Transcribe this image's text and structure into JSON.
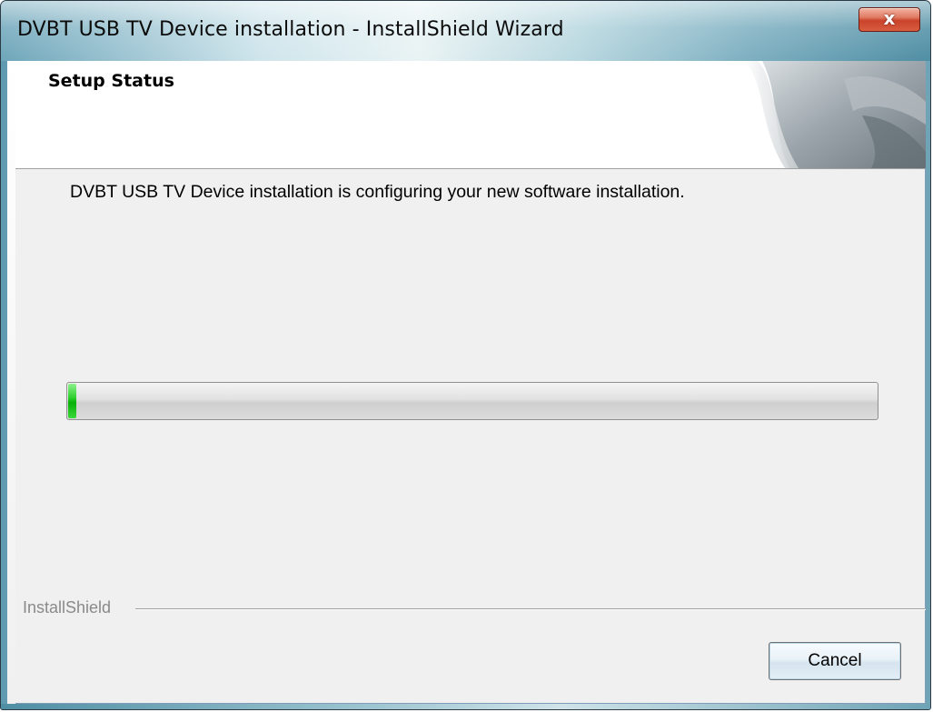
{
  "window": {
    "title": "DVBT USB TV Device installation - InstallShield Wizard",
    "close_label": "x"
  },
  "header": {
    "title": "Setup Status"
  },
  "main": {
    "message": "DVBT USB TV Device installation is configuring your new software installation.",
    "progress": {
      "fraction": 0.01,
      "color": "#22c722"
    }
  },
  "footer": {
    "brand": "InstallShield",
    "cancel_label": "Cancel"
  }
}
